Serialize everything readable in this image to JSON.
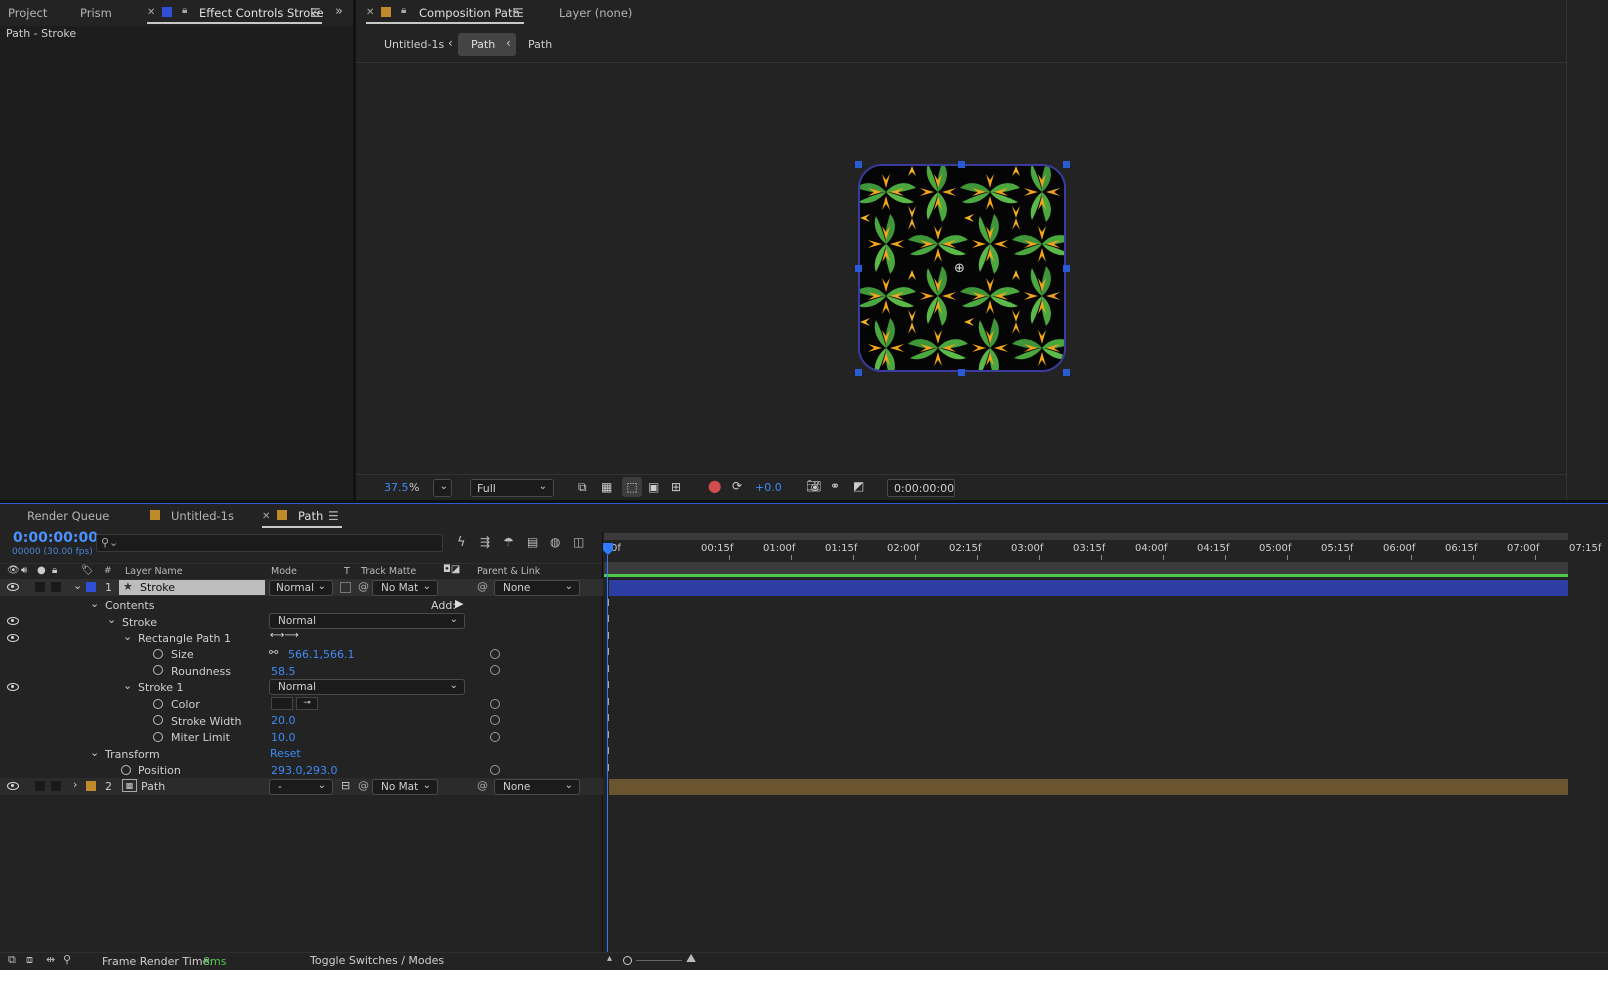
{
  "project_panel": {
    "tabs": [
      "Project",
      "Prism"
    ],
    "effect_controls_tab": "Effect Controls Stroke",
    "breadcrumb": "Path - Stroke"
  },
  "composition_panel": {
    "tab_label": "Composition Path",
    "layer_tab": "Layer (none)",
    "nav_items": [
      "Untitled-1s",
      "Path",
      "Path"
    ],
    "zoom": "37.5",
    "zoom_unit": "%",
    "resolution": "Full",
    "exposure": "+0.0",
    "timecode": "0:00:00:00"
  },
  "timeline_panel": {
    "tabs": [
      "Render Queue",
      "Untitled-1s",
      "Path"
    ],
    "timecode": "0:00:00:00",
    "frame_info": "00000 (30.00 fps)",
    "search_placeholder": "",
    "columns": {
      "hash": "#",
      "layer_name": "Layer Name",
      "mode": "Mode",
      "t": "T",
      "track_matte": "Track Matte",
      "parent": "Parent & Link"
    },
    "ruler": [
      "0f",
      "00:15f",
      "01:00f",
      "01:15f",
      "02:00f",
      "02:15f",
      "03:00f",
      "03:15f",
      "04:00f",
      "04:15f",
      "05:00f",
      "05:15f",
      "06:00f",
      "06:15f",
      "07:00f",
      "07:15f"
    ],
    "layer1": {
      "num": "1",
      "name": "Stroke",
      "mode": "Normal",
      "matte": "No Mat",
      "parent": "None"
    },
    "contents": "Contents",
    "add_label": "Add:",
    "stroke_group": "Stroke",
    "stroke_group_mode": "Normal",
    "rect_path": "Rectangle Path 1",
    "size_label": "Size",
    "size_value": "566.1,566.1",
    "roundness_label": "Roundness",
    "roundness_value": "58.5",
    "stroke1": "Stroke 1",
    "stroke1_mode": "Normal",
    "color_label": "Color",
    "stroke_width_label": "Stroke Width",
    "stroke_width_value": "20.0",
    "miter_label": "Miter Limit",
    "miter_value": "10.0",
    "transform": "Transform",
    "reset": "Reset",
    "position_label": "Position",
    "position_value": "293.0,293.0",
    "layer2": {
      "num": "2",
      "name": "Path",
      "mode": "-",
      "matte": "No Mat",
      "parent": "None"
    },
    "footer_render_label": "Frame Render Time:",
    "footer_render_value": "8ms",
    "footer_toggle": "Toggle Switches / Modes"
  },
  "colors": {
    "layer1_bar": "#2c3ea3",
    "layer2_bar": "#6b5530",
    "accent_blue": "#3d8bf5",
    "green_ok": "#4ec94e"
  }
}
